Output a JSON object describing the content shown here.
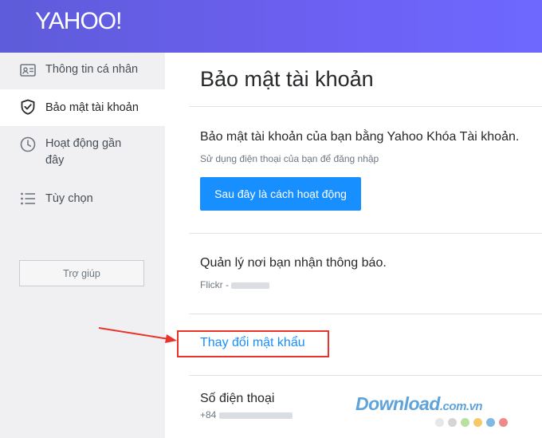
{
  "header": {
    "logo": "YAHOO!"
  },
  "sidebar": {
    "items": [
      {
        "label": "Thông tin cá nhân",
        "icon": "id-card-icon"
      },
      {
        "label": "Bảo mật tài khoản",
        "icon": "shield-icon",
        "active": true
      },
      {
        "label": "Hoạt động gần",
        "label2": "đây",
        "icon": "clock-icon"
      },
      {
        "label": "Tùy chọn",
        "icon": "list-icon"
      }
    ],
    "help_label": "Trợ giúp"
  },
  "main": {
    "title": "Bảo mật tài khoản",
    "account_key": {
      "title": "Bảo mật tài khoản của bạn bằng Yahoo Khóa Tài khoản.",
      "subtitle": "Sử dụng điện thoại của bạn để đăng nhập",
      "button_label": "Sau đây là cách hoạt động"
    },
    "notifications": {
      "title": "Quản lý nơi bạn nhận thông báo.",
      "sub_prefix": "Flickr -"
    },
    "change_password_link": "Thay đổi mật khẩu",
    "phone": {
      "title": "Số điện thoại",
      "prefix": "+84"
    }
  },
  "watermark": {
    "text": "Download",
    "suffix": ".com.vn"
  },
  "colors": {
    "header": "#6b5ff0",
    "primary": "#188fff",
    "annotation": "#e8342d",
    "watermark": "#5ea3da"
  },
  "watermark_dots": [
    "#e7e7e7",
    "#d5d5d5",
    "#b7e0a2",
    "#f5c86a",
    "#7fb8e2",
    "#f08a8a"
  ]
}
